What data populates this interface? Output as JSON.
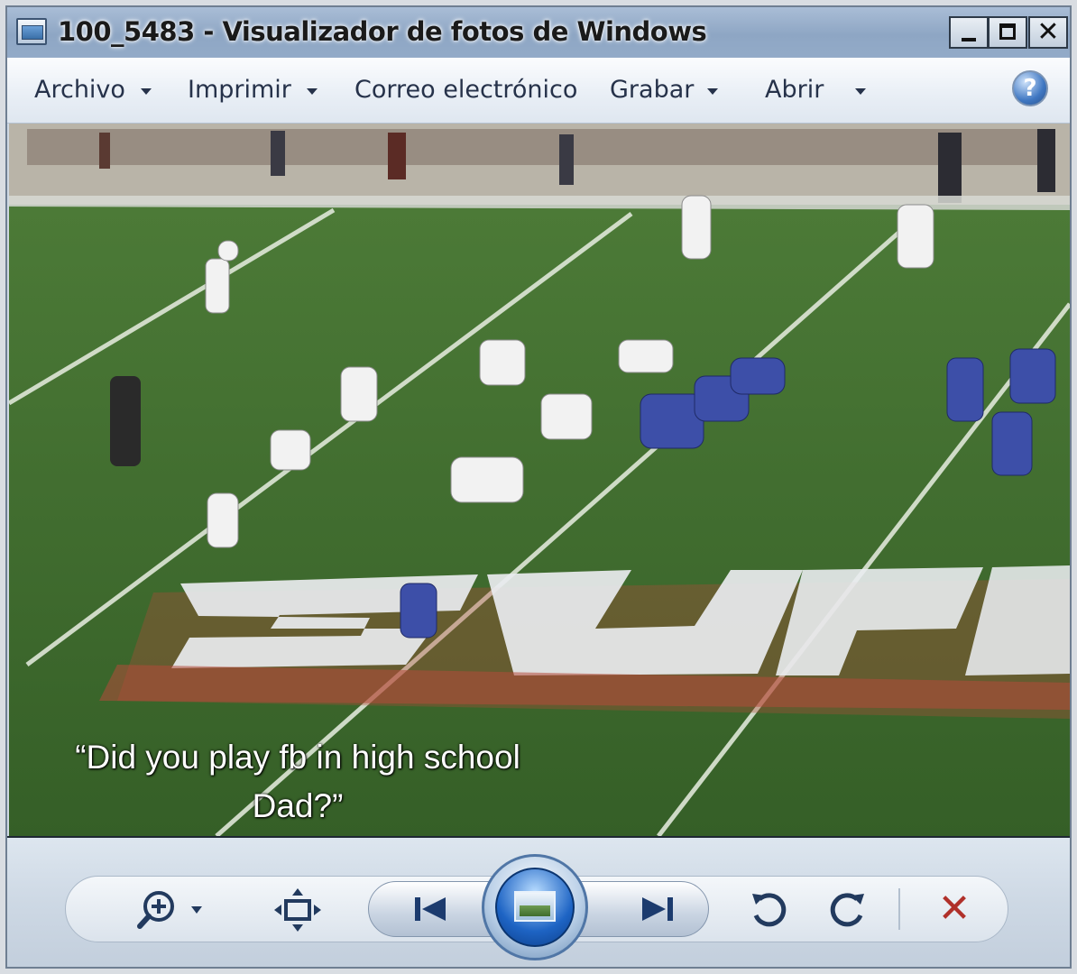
{
  "window": {
    "title": "100_5483 - Visualizador de fotos de Windows",
    "controls": {
      "minimize": "minimize-button",
      "maximize": "maximize-button",
      "close_glyph": "✕"
    }
  },
  "menu": {
    "items": [
      {
        "label": "Archivo",
        "has_dropdown": true
      },
      {
        "label": "Imprimir",
        "has_dropdown": true
      },
      {
        "label": "Correo electrónico",
        "has_dropdown": false
      },
      {
        "label": "Grabar",
        "has_dropdown": true
      },
      {
        "label": "Abrir",
        "has_dropdown": true
      }
    ],
    "help_glyph": "?"
  },
  "photo": {
    "caption_line1": "“Did you play fb in high school",
    "caption_line2": "Dad?”",
    "colors": {
      "grass": "#3f6b2f",
      "field_paint_white": "#e9ecef",
      "field_paint_red": "#b44a3a",
      "team_blue": "#3d4fa8"
    }
  },
  "toolbar": {
    "zoom_icon": "zoom-icon",
    "actual_size_icon": "fit-to-window-icon",
    "previous_icon": "previous-icon",
    "slideshow_icon": "slideshow-icon",
    "next_icon": "next-icon",
    "rotate_left_icon": "rotate-counterclockwise-icon",
    "rotate_right_icon": "rotate-clockwise-icon",
    "delete_glyph": "✕"
  }
}
